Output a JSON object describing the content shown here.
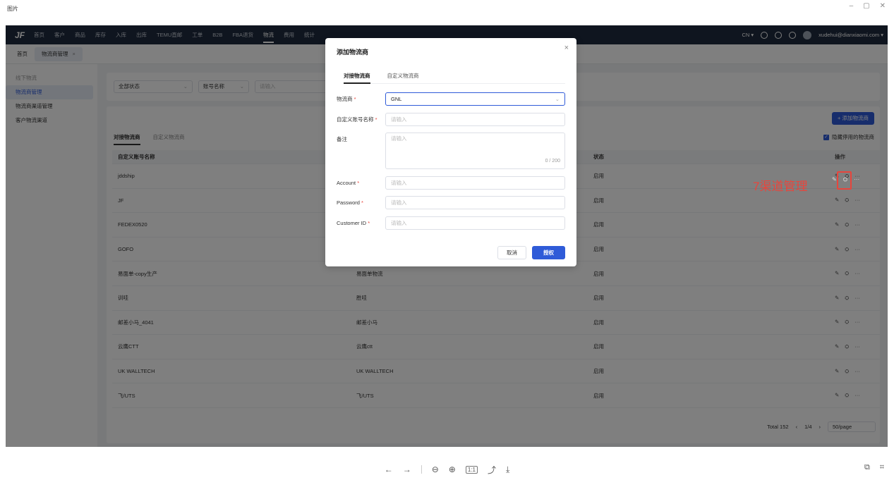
{
  "viewer": {
    "title": "图片",
    "window_controls": [
      "–",
      "▢",
      "✕"
    ],
    "toolbar": [
      "←",
      "→",
      "⊖",
      "⊕",
      "1:1",
      "⤴",
      "⤓"
    ],
    "right_tools": [
      "⧉",
      "⌗"
    ]
  },
  "app": {
    "logo": "JF",
    "nav": [
      "首页",
      "客户",
      "商品",
      "库存",
      "入库",
      "出库",
      "TEMU直邮",
      "工单",
      "B2B",
      "FBA退货",
      "物流",
      "费用",
      "统计"
    ],
    "nav_active": "物流",
    "nav_right": {
      "lang": "CN ▾",
      "user": "xudehui@dianxiaomi.com ▾"
    },
    "tabs": [
      "首页",
      "物流商管理"
    ],
    "tab_close": "×",
    "sidebar": {
      "group": "线下物流",
      "items": [
        "物流商管理",
        "物流商渠道管理",
        "客户物流渠道"
      ]
    },
    "filters": {
      "status": "全部状态",
      "field": "账号名称",
      "placeholder": "请输入"
    },
    "panel": {
      "add_button": "+ 添加物流商",
      "hide_disabled": "隐藏停用的物流商",
      "checkmark": "✓",
      "subtabs": [
        "对接物流商",
        "自定义物流商"
      ],
      "columns": [
        "自定义账号名称",
        "",
        "状态",
        "操作"
      ],
      "rows": [
        {
          "name": "jddship",
          "carrier": "",
          "status": "启用"
        },
        {
          "name": "JF",
          "carrier": "",
          "status": "启用"
        },
        {
          "name": "FEDEX0520",
          "carrier": "",
          "status": "启用"
        },
        {
          "name": "GOFO",
          "carrier": "",
          "status": "启用"
        },
        {
          "name": "易面单-copy生产",
          "carrier": "易面单物流",
          "status": "启用"
        },
        {
          "name": "训哇",
          "carrier": "胜哇",
          "status": "启用"
        },
        {
          "name": "邮差小马_4041",
          "carrier": "邮差小马",
          "status": "启用"
        },
        {
          "name": "云鹰CTT",
          "carrier": "云鹰ctt",
          "status": "启用"
        },
        {
          "name": "UK WALLTECH",
          "carrier": "UK WALLTECH",
          "status": "启用"
        },
        {
          "name": "飞/UTS",
          "carrier": "飞/UTS",
          "status": "启用"
        }
      ],
      "row_actions": [
        "✎",
        "⛭",
        "···"
      ],
      "pager": {
        "total": "Total 152",
        "page": "1/4",
        "prev": "‹",
        "next": "›",
        "size": "50/page"
      }
    }
  },
  "annotation": {
    "text": "7渠道管理",
    "color": "#e8453c"
  },
  "modal": {
    "title": "添加物流商",
    "close": "×",
    "tabs": [
      "对接物流商",
      "自定义物流商"
    ],
    "fields": {
      "carrier_label": "物流商",
      "carrier_value": "GNL",
      "account_name_label": "自定义账号名称",
      "remark_label": "备注",
      "account_label": "Account",
      "password_label": "Password",
      "customer_id_label": "Customer ID",
      "placeholder": "请输入",
      "counter": "0 / 200",
      "required_mark": "*"
    },
    "buttons": {
      "cancel": "取消",
      "authorize": "授权"
    }
  },
  "colors": {
    "primary": "#2f5bd8",
    "nav_bg": "#1f2b3e",
    "annotation": "#e8453c"
  }
}
